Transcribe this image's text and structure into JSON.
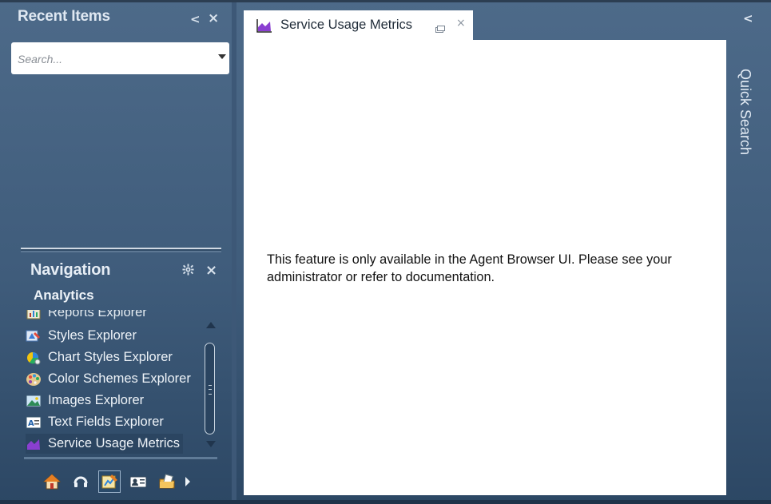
{
  "recent_items": {
    "title": "Recent Items",
    "collapse_label": "<",
    "close_label": "×",
    "search": {
      "placeholder": "Search...",
      "value": ""
    }
  },
  "navigation": {
    "title": "Navigation",
    "section": "Analytics",
    "close_label": "×",
    "items": [
      {
        "label": "Reports Explorer",
        "icon": "reports-icon"
      },
      {
        "label": "Styles Explorer",
        "icon": "styles-icon"
      },
      {
        "label": "Chart Styles Explorer",
        "icon": "chart-styles-icon"
      },
      {
        "label": "Color Schemes Explorer",
        "icon": "color-schemes-icon"
      },
      {
        "label": "Images Explorer",
        "icon": "images-icon"
      },
      {
        "label": "Text Fields Explorer",
        "icon": "text-fields-icon"
      },
      {
        "label": "Service Usage Metrics",
        "icon": "service-usage-icon",
        "selected": true
      }
    ],
    "bottom_icons": [
      "home-icon",
      "service-icon",
      "analytics-icon",
      "contacts-icon",
      "knowledge-icon",
      "more-arrow-icon"
    ]
  },
  "tab": {
    "label": "Service Usage Metrics",
    "close_label": "×"
  },
  "content": {
    "message": "This feature is only available in the Agent Browser UI. Please see your administrator or refer to documentation."
  },
  "quick_search": {
    "label": "Quick Search",
    "collapse_label": "<"
  },
  "colors": {
    "background": "#4d6a89",
    "accent_purple": "#8a3fd1",
    "content_bg": "#ffffff"
  }
}
